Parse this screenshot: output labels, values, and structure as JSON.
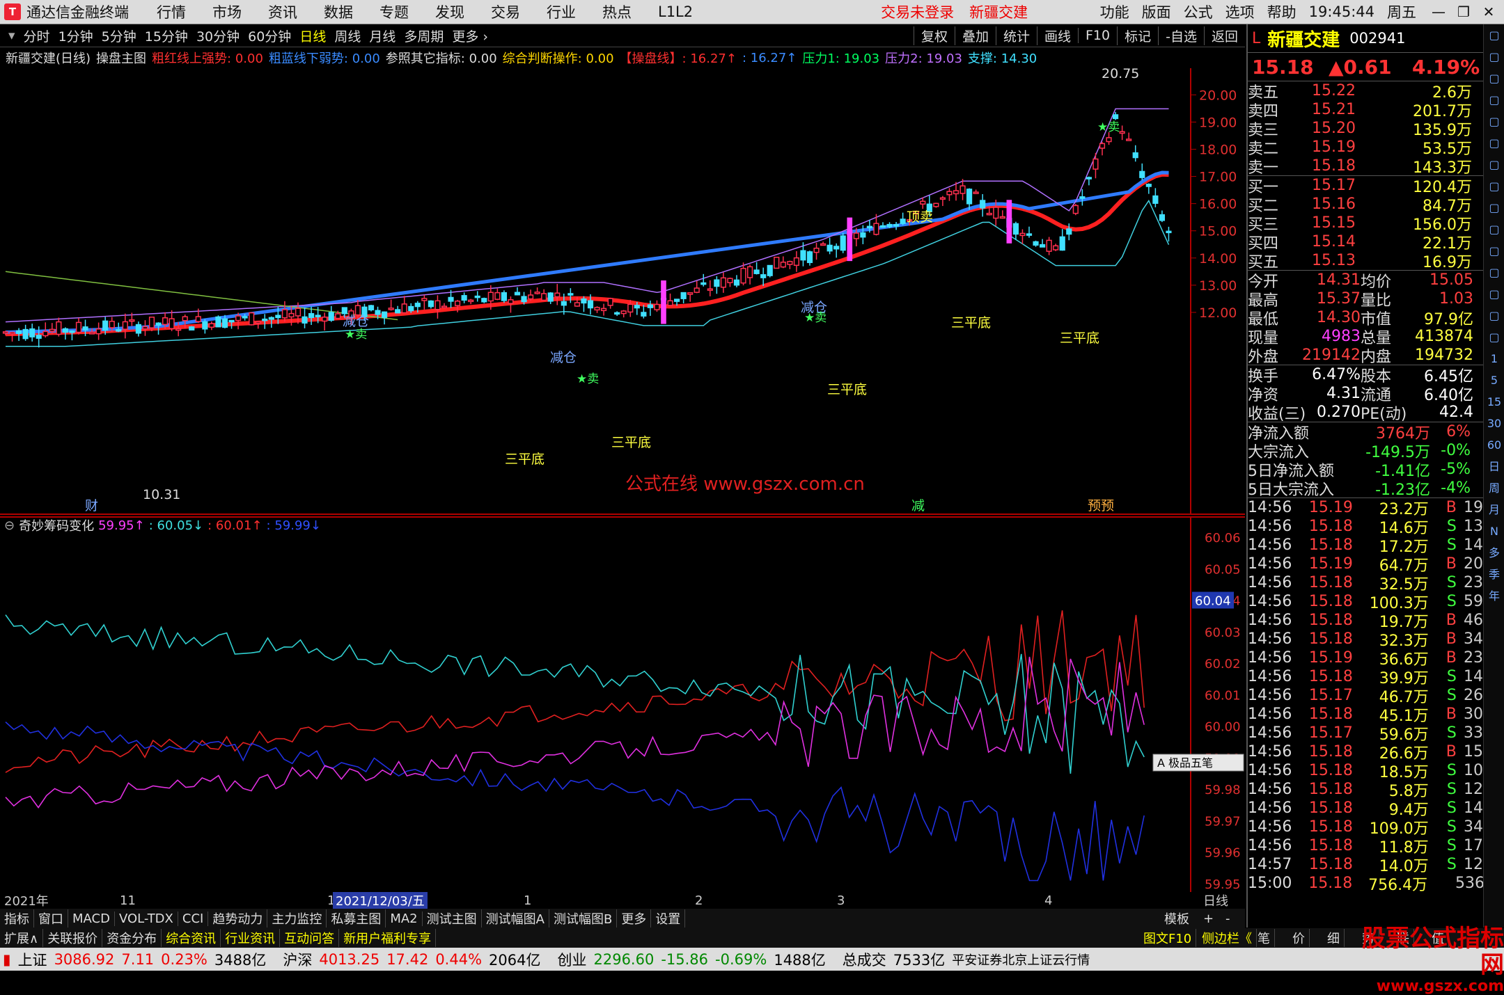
{
  "menubar": {
    "app_title": "通达信金融终端",
    "items": [
      "行情",
      "市场",
      "资讯",
      "数据",
      "专题",
      "发现",
      "交易",
      "行业",
      "热点",
      "L1L2"
    ],
    "alerts": [
      "交易未登录",
      "新疆交建"
    ],
    "right_items": [
      "功能",
      "版面",
      "公式",
      "选项",
      "帮助"
    ],
    "time": "19:45:44",
    "weekday": "周五"
  },
  "toolbar": {
    "periods": [
      "分时",
      "1分钟",
      "5分钟",
      "15分钟",
      "30分钟",
      "60分钟",
      "日线",
      "周线",
      "月线",
      "多周期",
      "更多 ›"
    ],
    "active_period": "日线",
    "right_buttons": [
      "复权",
      "叠加",
      "统计",
      "画线",
      "F10",
      "标记",
      "-自选",
      "返回"
    ]
  },
  "infoline": {
    "stock": "新疆交建(日线)",
    "indicator": "操盘主图",
    "items": [
      {
        "text": "粗红线上强势: 0.00",
        "color": "#ff3030"
      },
      {
        "text": "粗蓝线下弱势: 0.00",
        "color": "#3a8bff"
      },
      {
        "text": "参照其它指标: 0.00",
        "color": "#dddddd"
      },
      {
        "text": "综合判断操作: 0.00",
        "color": "#ffd700"
      },
      {
        "text": "【操盘线】: 16.27↑",
        "color": "#ff3030"
      },
      {
        "text": ": 16.27↑",
        "color": "#3a8bff"
      },
      {
        "text": "压力1: 19.03",
        "color": "#00ff60"
      },
      {
        "text": "压力2: 19.03",
        "color": "#c070ff"
      },
      {
        "text": "支撑: 14.30",
        "color": "#40e0ff"
      }
    ]
  },
  "main_chart": {
    "price_ticks": [
      "20.00",
      "19.00",
      "18.00",
      "17.00",
      "16.00",
      "15.00",
      "14.00",
      "13.00",
      "12.00"
    ],
    "high_label": "20.75",
    "low_label": "10.31",
    "watermark": "公式在线 www.gszx.com.cn",
    "signals": {
      "reduce": "减仓",
      "sell": "卖",
      "top": "顶卖",
      "three_bottom": "三平底",
      "cai": "财",
      "jian": "减",
      "yuyu": "预预"
    }
  },
  "sub_chart": {
    "title": "奇妙筹码变化",
    "values": [
      {
        "text": "59.95↑",
        "color": "#ff40ff"
      },
      {
        "text": ": 60.05↓",
        "color": "#40e0e0"
      },
      {
        "text": ": 60.01↑",
        "color": "#ff3030"
      },
      {
        "text": ": 59.99↓",
        "color": "#3050ff"
      }
    ],
    "ticks": [
      "60.06",
      "60.05",
      "60.04",
      "60.03",
      "60.02",
      "60.01",
      "60.00",
      "59.99",
      "59.98",
      "59.97",
      "59.96",
      "59.95"
    ],
    "current_label": "60.04",
    "ime_label": "极品五笔"
  },
  "time_axis": {
    "labels": [
      "2021年",
      "11",
      "12",
      "2021/12/03/五",
      "1",
      "2",
      "3",
      "4"
    ],
    "period": "日线"
  },
  "tabs1": [
    "指标",
    "窗口",
    "MACD",
    "VOL-TDX",
    "CCI",
    "趋势动力",
    "主力监控",
    "私募主图",
    "MA2",
    "测试主图",
    "测试幅图A",
    "测试幅图B",
    "更多",
    "设置"
  ],
  "tabs1_right": [
    "模板",
    "+",
    "-"
  ],
  "tabs2": [
    "扩展∧",
    "关联报价",
    "资金分布",
    "综合资讯",
    "行业资讯",
    "互动问答",
    "新用户福利专享"
  ],
  "tabs2_right": [
    "图文F10",
    "侧边栏《",
    "笔",
    "价",
    "细",
    "势",
    "联",
    "值"
  ],
  "panel": {
    "code_prefix": "L",
    "name": "新疆交建",
    "code": "002941",
    "price": "15.18",
    "change": "▲0.61",
    "pct": "4.19%",
    "asks": [
      {
        "label": "卖五",
        "price": "15.22",
        "vol": "2.6万"
      },
      {
        "label": "卖四",
        "price": "15.21",
        "vol": "201.7万"
      },
      {
        "label": "卖三",
        "price": "15.20",
        "vol": "135.9万"
      },
      {
        "label": "卖二",
        "price": "15.19",
        "vol": "53.5万"
      },
      {
        "label": "卖一",
        "price": "15.18",
        "vol": "143.3万"
      }
    ],
    "bids": [
      {
        "label": "买一",
        "price": "15.17",
        "vol": "120.4万"
      },
      {
        "label": "买二",
        "price": "15.16",
        "vol": "84.7万"
      },
      {
        "label": "买三",
        "price": "15.15",
        "vol": "156.0万"
      },
      {
        "label": "买四",
        "price": "15.14",
        "vol": "22.1万"
      },
      {
        "label": "买五",
        "price": "15.13",
        "vol": "16.9万"
      }
    ],
    "stats": [
      [
        "今开",
        "14.31",
        "均价",
        "15.05"
      ],
      [
        "最高",
        "15.37",
        "量比",
        "1.03"
      ],
      [
        "最低",
        "14.30",
        "市值",
        "97.9亿"
      ],
      [
        "现量",
        "4983",
        "总量",
        "413874"
      ],
      [
        "外盘",
        "219142",
        "内盘",
        "194732"
      ]
    ],
    "stats2": [
      [
        "换手",
        "6.47%",
        "股本",
        "6.45亿"
      ],
      [
        "净资",
        "4.31",
        "流通",
        "6.40亿"
      ],
      [
        "收益(三)",
        "0.270",
        "PE(动)",
        "42.4"
      ]
    ],
    "flows": [
      {
        "label": "净流入额",
        "val": "3764万",
        "pct": "6%"
      },
      {
        "label": "大宗流入",
        "val": "-149.5万",
        "pct": "-0%"
      },
      {
        "label": "5日净流入额",
        "val": "-1.41亿",
        "pct": "-5%"
      },
      {
        "label": "5日大宗流入",
        "val": "-1.23亿",
        "pct": "-4%"
      }
    ],
    "ticks": [
      [
        "14:56",
        "15.19",
        "23.2万",
        "B",
        "19"
      ],
      [
        "14:56",
        "15.18",
        "14.6万",
        "S",
        "13"
      ],
      [
        "14:56",
        "15.18",
        "17.2万",
        "S",
        "14"
      ],
      [
        "14:56",
        "15.19",
        "64.7万",
        "B",
        "20"
      ],
      [
        "14:56",
        "15.18",
        "32.5万",
        "S",
        "23"
      ],
      [
        "14:56",
        "15.18",
        "100.3万",
        "S",
        "59"
      ],
      [
        "14:56",
        "15.18",
        "19.7万",
        "B",
        "46"
      ],
      [
        "14:56",
        "15.18",
        "32.3万",
        "B",
        "34"
      ],
      [
        "14:56",
        "15.19",
        "36.6万",
        "B",
        "23"
      ],
      [
        "14:56",
        "15.18",
        "39.9万",
        "S",
        "14"
      ],
      [
        "14:56",
        "15.17",
        "46.7万",
        "S",
        "26"
      ],
      [
        "14:56",
        "15.18",
        "45.1万",
        "B",
        "30"
      ],
      [
        "14:56",
        "15.17",
        "59.6万",
        "S",
        "33"
      ],
      [
        "14:56",
        "15.18",
        "26.6万",
        "B",
        "15"
      ],
      [
        "14:56",
        "15.18",
        "18.5万",
        "S",
        "10"
      ],
      [
        "14:56",
        "15.18",
        "5.8万",
        "S",
        "12"
      ],
      [
        "14:56",
        "15.18",
        "9.4万",
        "S",
        "14"
      ],
      [
        "14:56",
        "15.18",
        "109.0万",
        "S",
        "34"
      ],
      [
        "14:56",
        "15.18",
        "11.8万",
        "S",
        "17"
      ],
      [
        "14:57",
        "15.18",
        "14.0万",
        "S",
        "12"
      ],
      [
        "15:00",
        "15.18",
        "756.4万",
        "",
        "536"
      ]
    ]
  },
  "side_icons": [
    "1",
    "5",
    "15",
    "30",
    "60",
    "日",
    "周",
    "月",
    "N",
    "多",
    "季",
    "年"
  ],
  "statusbar": {
    "items": [
      {
        "name": "上证",
        "val": "3086.92",
        "chg": "7.11",
        "pct": "0.23%",
        "amt": "3488亿"
      },
      {
        "name": "沪深",
        "val": "4013.25",
        "chg": "17.42",
        "pct": "0.44%",
        "amt": "2064亿"
      },
      {
        "name": "创业",
        "val": "2296.60",
        "chg": "-15.86",
        "pct": "-0.69%",
        "amt": "1488亿"
      }
    ],
    "total_label": "总成交",
    "total_val": "7533亿",
    "broker": "平安证券北京上证云行情"
  },
  "brand": {
    "title": "股票公式指标网",
    "url": "www.gszx.com"
  }
}
